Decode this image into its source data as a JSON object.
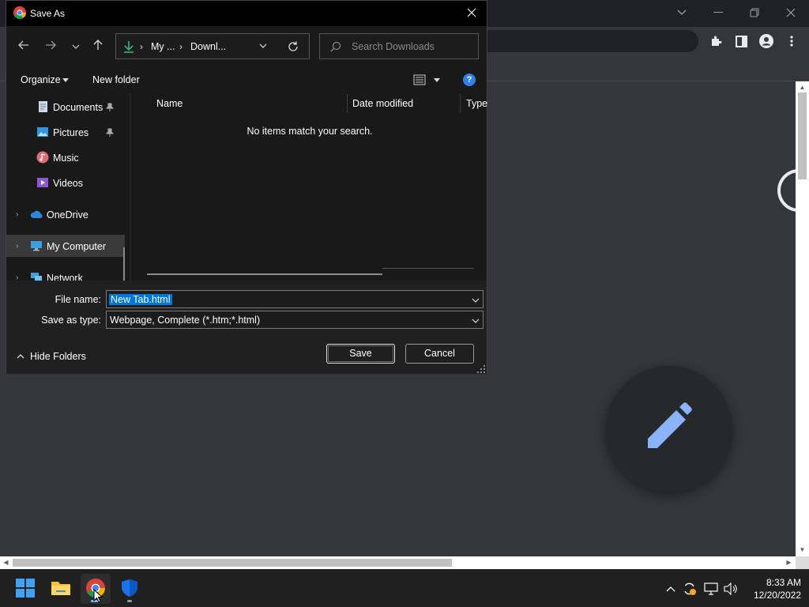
{
  "dialog": {
    "title": "Save As",
    "address": {
      "crumb1": "My ...",
      "crumb2": "Downl..."
    },
    "search_placeholder": "Search Downloads",
    "toolbar": {
      "organize_label": "Organize",
      "new_folder_label": "New folder"
    },
    "nav_items": [
      {
        "label": "Documents",
        "pinned": true
      },
      {
        "label": "Pictures",
        "pinned": true
      },
      {
        "label": "Music"
      },
      {
        "label": "Videos"
      },
      {
        "label": "OneDrive"
      },
      {
        "label": "My Computer",
        "selected": true
      },
      {
        "label": "Network"
      }
    ],
    "columns": {
      "name": "Name",
      "date_modified": "Date modified",
      "type": "Type"
    },
    "empty_message": "No items match your search.",
    "file_name_label": "File name:",
    "file_name_value": "New Tab.html",
    "save_type_label": "Save as type:",
    "save_type_value": "Webpage, Complete (*.htm;*.html)",
    "hide_folders_label": "Hide Folders",
    "save_label": "Save",
    "cancel_label": "Cancel"
  },
  "taskbar": {
    "apps": [
      "windows-start",
      "file-explorer",
      "chrome",
      "windows-security"
    ],
    "active_app": "chrome",
    "clock": {
      "time": "8:33 AM",
      "date": "12/20/2022"
    }
  },
  "colors": {
    "dialog_bg": "#202020",
    "chrome_bg": "#35363a",
    "selection": "#0078d7",
    "accent_pencil": "#8ab4f8"
  }
}
